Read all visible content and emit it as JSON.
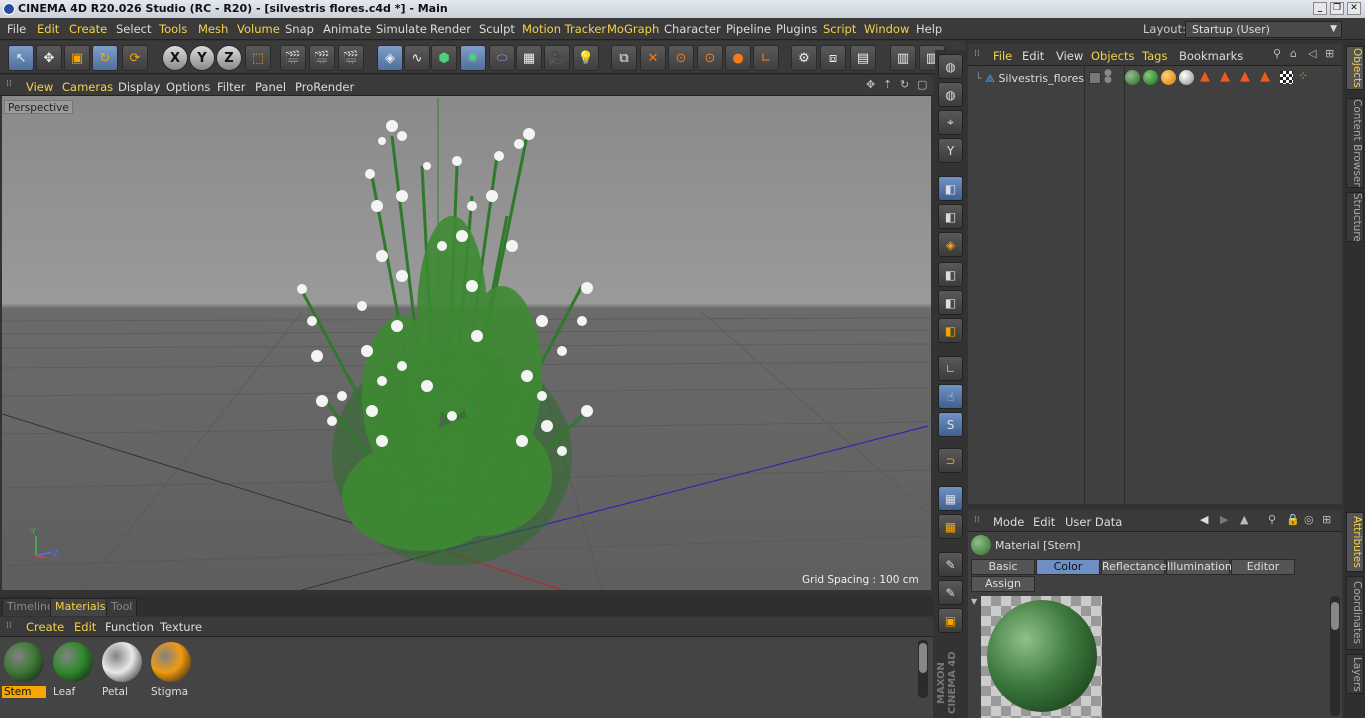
{
  "window": {
    "title": "CINEMA 4D R20.026 Studio (RC - R20) - [silvestris flores.c4d *] - Main"
  },
  "menubar": {
    "items": [
      {
        "label": "File",
        "highlight": false
      },
      {
        "label": "Edit",
        "highlight": true
      },
      {
        "label": "Create",
        "highlight": true
      },
      {
        "label": "Select",
        "highlight": false
      },
      {
        "label": "Tools",
        "highlight": true
      },
      {
        "label": "Mesh",
        "highlight": true
      },
      {
        "label": "Volume",
        "highlight": true
      },
      {
        "label": "Snap",
        "highlight": false
      },
      {
        "label": "Animate",
        "highlight": false
      },
      {
        "label": "Simulate",
        "highlight": false
      },
      {
        "label": "Render",
        "highlight": false
      },
      {
        "label": "Sculpt",
        "highlight": false
      },
      {
        "label": "Motion Tracker",
        "highlight": true
      },
      {
        "label": "MoGraph",
        "highlight": true
      },
      {
        "label": "Character",
        "highlight": false
      },
      {
        "label": "Pipeline",
        "highlight": false
      },
      {
        "label": "Plugins",
        "highlight": false
      },
      {
        "label": "Script",
        "highlight": true
      },
      {
        "label": "Window",
        "highlight": true
      },
      {
        "label": "Help",
        "highlight": false
      }
    ],
    "layout_label": "Layout:",
    "layout_value": "Startup (User)"
  },
  "viewport": {
    "menu": [
      {
        "label": "View",
        "highlight": true
      },
      {
        "label": "Cameras",
        "highlight": true
      },
      {
        "label": "Display",
        "highlight": false
      },
      {
        "label": "Options",
        "highlight": false
      },
      {
        "label": "Filter",
        "highlight": false
      },
      {
        "label": "Panel",
        "highlight": false
      },
      {
        "label": "ProRender",
        "highlight": false
      }
    ],
    "camera_label": "Perspective",
    "grid_spacing": "Grid Spacing : 100 cm"
  },
  "bottom": {
    "tabs": [
      {
        "label": "Timeline",
        "active": false
      },
      {
        "label": "Materials",
        "active": true
      },
      {
        "label": "Tool",
        "active": false
      }
    ],
    "mat_menu": [
      {
        "label": "Create",
        "highlight": true
      },
      {
        "label": "Edit",
        "highlight": true
      },
      {
        "label": "Function",
        "highlight": false
      },
      {
        "label": "Texture",
        "highlight": false
      }
    ],
    "materials": [
      {
        "label": "Stem",
        "color": "#3e7a35",
        "selected": true
      },
      {
        "label": "Leaf",
        "color": "#2f8a2c",
        "selected": false
      },
      {
        "label": "Petal",
        "color": "#e9e9e9",
        "selected": false
      },
      {
        "label": "Stigma",
        "color": "#f19a12",
        "selected": false
      }
    ]
  },
  "object_manager": {
    "menu": [
      {
        "label": "File",
        "highlight": true
      },
      {
        "label": "Edit",
        "highlight": false
      },
      {
        "label": "View",
        "highlight": false
      },
      {
        "label": "Objects",
        "highlight": true
      },
      {
        "label": "Tags",
        "highlight": true
      },
      {
        "label": "Bookmarks",
        "highlight": false
      }
    ],
    "object_name": "Silvestris_flores"
  },
  "attributes": {
    "menu": [
      {
        "label": "Mode",
        "highlight": false
      },
      {
        "label": "Edit",
        "highlight": false
      },
      {
        "label": "User Data",
        "highlight": false
      }
    ],
    "material_title": "Material [Stem]",
    "tabs": [
      {
        "label": "Basic",
        "active": false
      },
      {
        "label": "Color",
        "active": true
      },
      {
        "label": "Reflectance",
        "active": false
      },
      {
        "label": "Illumination",
        "active": false
      },
      {
        "label": "Editor",
        "active": false
      },
      {
        "label": "Assign",
        "active": false
      }
    ]
  },
  "side_tabs": [
    {
      "label": "Objects",
      "active": true
    },
    {
      "label": "Content Browser",
      "active": false
    },
    {
      "label": "Structure",
      "active": false
    },
    {
      "label": "Attributes",
      "active": true
    },
    {
      "label": "Coordinates",
      "active": false
    },
    {
      "label": "Layers",
      "active": false
    }
  ],
  "branding": "MAXON CINEMA 4D",
  "colors": {
    "accent": "#f5d24a",
    "selection": "#6d8fc4"
  }
}
